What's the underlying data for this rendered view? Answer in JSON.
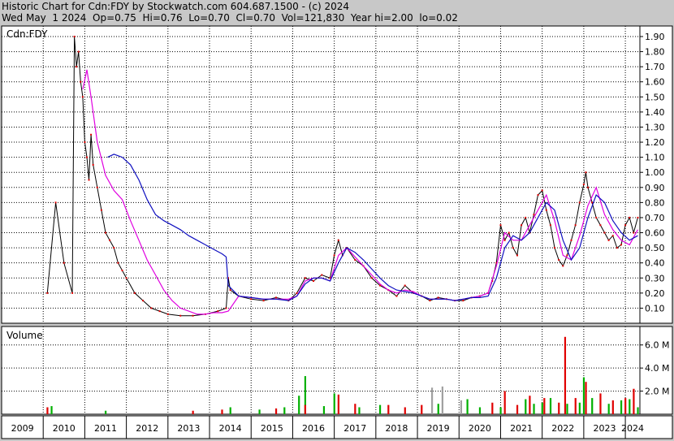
{
  "header": {
    "line1": "Historic Chart for Cdn:FDY by Stockwatch.com 604.687.1500 - (c) 2024",
    "line2": "Wed May  1 2024  Op=0.75  Hi=0.76  Lo=0.70  Cl=0.70  Vol=121,830  Year hi=2.00  lo=0.02"
  },
  "chart_data": [
    {
      "type": "line",
      "name": "price-panel",
      "title": "Cdn:FDY",
      "ylim": [
        0.0,
        1.97
      ],
      "yticks": [
        0.1,
        0.2,
        0.3,
        0.4,
        0.5,
        0.6,
        0.7,
        0.8,
        0.9,
        1.0,
        1.1,
        1.2,
        1.3,
        1.4,
        1.5,
        1.6,
        1.7,
        1.8,
        1.9
      ],
      "ytick_labels": [
        "0.10",
        "0.20",
        "0.30",
        "0.40",
        "0.50",
        "0.60",
        "0.70",
        "0.80",
        "0.90",
        "1.00",
        "1.10",
        "1.20",
        "1.30",
        "1.40",
        "1.50",
        "1.60",
        "1.70",
        "1.80",
        "1.90"
      ],
      "xlim": [
        2009.0,
        2024.35
      ],
      "series": [
        {
          "role": "price",
          "color": "#000000",
          "x": [
            2010.1,
            2010.3,
            2010.5,
            2010.7,
            2010.75,
            2010.8,
            2010.85,
            2010.9,
            2010.95,
            2011.0,
            2011.05,
            2011.1,
            2011.15,
            2011.2,
            2011.3,
            2011.4,
            2011.5,
            2011.6,
            2011.7,
            2011.8,
            2011.9,
            2012.0,
            2012.2,
            2012.4,
            2012.6,
            2012.8,
            2013.0,
            2013.3,
            2013.6,
            2013.9,
            2014.2,
            2014.4,
            2014.45,
            2014.5,
            2014.7,
            2015.0,
            2015.3,
            2015.6,
            2015.9,
            2016.1,
            2016.3,
            2016.5,
            2016.7,
            2016.9,
            2017.0,
            2017.1,
            2017.2,
            2017.3,
            2017.5,
            2017.7,
            2017.9,
            2018.1,
            2018.3,
            2018.5,
            2018.7,
            2018.9,
            2019.1,
            2019.3,
            2019.5,
            2019.7,
            2019.9,
            2020.1,
            2020.3,
            2020.5,
            2020.7,
            2020.8,
            2020.9,
            2021.0,
            2021.1,
            2021.2,
            2021.3,
            2021.4,
            2021.5,
            2021.6,
            2021.7,
            2021.8,
            2021.9,
            2022.0,
            2022.1,
            2022.2,
            2022.3,
            2022.4,
            2022.5,
            2022.6,
            2022.7,
            2022.8,
            2022.9,
            2023.0,
            2023.05,
            2023.1,
            2023.2,
            2023.3,
            2023.4,
            2023.5,
            2023.6,
            2023.7,
            2023.8,
            2023.9,
            2024.0,
            2024.1,
            2024.2,
            2024.3
          ],
          "y": [
            0.2,
            0.8,
            0.4,
            0.2,
            1.9,
            1.7,
            1.8,
            1.6,
            1.5,
            1.2,
            1.1,
            0.95,
            1.25,
            1.05,
            0.9,
            0.75,
            0.6,
            0.55,
            0.5,
            0.4,
            0.35,
            0.3,
            0.2,
            0.15,
            0.1,
            0.08,
            0.06,
            0.05,
            0.05,
            0.06,
            0.08,
            0.1,
            0.3,
            0.22,
            0.18,
            0.16,
            0.15,
            0.17,
            0.15,
            0.2,
            0.3,
            0.28,
            0.32,
            0.3,
            0.45,
            0.55,
            0.45,
            0.5,
            0.42,
            0.38,
            0.3,
            0.25,
            0.22,
            0.18,
            0.25,
            0.2,
            0.18,
            0.15,
            0.17,
            0.16,
            0.15,
            0.15,
            0.17,
            0.18,
            0.2,
            0.28,
            0.4,
            0.65,
            0.55,
            0.6,
            0.5,
            0.45,
            0.65,
            0.7,
            0.6,
            0.72,
            0.85,
            0.88,
            0.75,
            0.65,
            0.5,
            0.42,
            0.38,
            0.45,
            0.55,
            0.65,
            0.8,
            0.92,
            1.0,
            0.9,
            0.8,
            0.7,
            0.65,
            0.6,
            0.55,
            0.58,
            0.5,
            0.52,
            0.65,
            0.7,
            0.6,
            0.7
          ]
        },
        {
          "role": "short-moving-average",
          "color": "#e000e0",
          "x": [
            2010.95,
            2011.05,
            2011.15,
            2011.3,
            2011.5,
            2011.7,
            2011.9,
            2012.1,
            2012.3,
            2012.5,
            2012.7,
            2012.9,
            2013.1,
            2013.3,
            2013.5,
            2013.7,
            2013.9,
            2014.1,
            2014.3,
            2014.45,
            2014.7,
            2015.0,
            2015.3,
            2015.6,
            2015.9,
            2016.1,
            2016.3,
            2016.5,
            2016.7,
            2016.9,
            2017.1,
            2017.3,
            2017.5,
            2017.7,
            2017.9,
            2018.1,
            2018.3,
            2018.5,
            2018.7,
            2018.9,
            2019.1,
            2019.3,
            2019.5,
            2019.7,
            2019.9,
            2020.1,
            2020.3,
            2020.5,
            2020.7,
            2020.9,
            2021.1,
            2021.3,
            2021.5,
            2021.7,
            2021.9,
            2022.1,
            2022.3,
            2022.5,
            2022.7,
            2022.9,
            2023.1,
            2023.3,
            2023.5,
            2023.7,
            2023.9,
            2024.1,
            2024.3
          ],
          "y": [
            1.55,
            1.68,
            1.5,
            1.2,
            0.98,
            0.88,
            0.82,
            0.68,
            0.55,
            0.42,
            0.32,
            0.22,
            0.15,
            0.1,
            0.08,
            0.06,
            0.06,
            0.07,
            0.07,
            0.08,
            0.18,
            0.17,
            0.16,
            0.16,
            0.16,
            0.18,
            0.28,
            0.3,
            0.3,
            0.28,
            0.45,
            0.5,
            0.44,
            0.38,
            0.32,
            0.26,
            0.22,
            0.2,
            0.22,
            0.21,
            0.18,
            0.16,
            0.16,
            0.16,
            0.15,
            0.16,
            0.17,
            0.18,
            0.2,
            0.38,
            0.6,
            0.55,
            0.55,
            0.65,
            0.75,
            0.85,
            0.68,
            0.45,
            0.42,
            0.58,
            0.78,
            0.9,
            0.72,
            0.62,
            0.55,
            0.52,
            0.62
          ]
        },
        {
          "role": "long-moving-average",
          "color": "#1010c0",
          "x": [
            2011.55,
            2011.7,
            2011.9,
            2012.1,
            2012.3,
            2012.5,
            2012.7,
            2012.9,
            2013.1,
            2013.3,
            2013.5,
            2013.7,
            2013.9,
            2014.1,
            2014.3,
            2014.4,
            2014.45,
            2014.7,
            2015.0,
            2015.3,
            2015.6,
            2015.9,
            2016.1,
            2016.3,
            2016.5,
            2016.7,
            2016.9,
            2017.1,
            2017.3,
            2017.5,
            2017.7,
            2017.9,
            2018.1,
            2018.3,
            2018.5,
            2018.7,
            2018.9,
            2019.1,
            2019.3,
            2019.5,
            2019.7,
            2019.9,
            2020.1,
            2020.3,
            2020.5,
            2020.7,
            2020.9,
            2021.1,
            2021.3,
            2021.5,
            2021.7,
            2021.9,
            2022.1,
            2022.3,
            2022.5,
            2022.7,
            2022.9,
            2023.1,
            2023.3,
            2023.5,
            2023.7,
            2023.9,
            2024.1,
            2024.3
          ],
          "y": [
            1.1,
            1.12,
            1.1,
            1.05,
            0.95,
            0.82,
            0.72,
            0.68,
            0.65,
            0.62,
            0.58,
            0.55,
            0.52,
            0.49,
            0.46,
            0.44,
            0.25,
            0.18,
            0.17,
            0.16,
            0.16,
            0.15,
            0.18,
            0.26,
            0.3,
            0.3,
            0.28,
            0.4,
            0.5,
            0.47,
            0.42,
            0.36,
            0.3,
            0.25,
            0.22,
            0.21,
            0.2,
            0.18,
            0.16,
            0.16,
            0.16,
            0.15,
            0.16,
            0.17,
            0.17,
            0.18,
            0.3,
            0.5,
            0.58,
            0.55,
            0.6,
            0.7,
            0.8,
            0.75,
            0.55,
            0.42,
            0.5,
            0.7,
            0.85,
            0.8,
            0.68,
            0.6,
            0.55,
            0.58
          ]
        }
      ]
    },
    {
      "type": "bar",
      "name": "volume-panel",
      "title": "Volume",
      "ylim": [
        0,
        7.6
      ],
      "yticks": [
        2.0,
        4.0,
        6.0
      ],
      "ytick_labels": [
        "2.0 M",
        "4.0 M",
        "6.0 M"
      ],
      "xlim": [
        2009.0,
        2024.35
      ],
      "series": [
        {
          "role": "volume-up",
          "color": "#00b000",
          "x": [
            2010.2,
            2011.5,
            2014.5,
            2015.2,
            2015.8,
            2016.15,
            2016.3,
            2016.75,
            2017.0,
            2017.6,
            2018.1,
            2019.5,
            2020.2,
            2020.5,
            2021.0,
            2021.6,
            2021.8,
            2022.0,
            2022.2,
            2022.6,
            2022.9,
            2023.0,
            2023.2,
            2023.6,
            2023.9,
            2024.1,
            2024.3
          ],
          "y": [
            0.7,
            0.3,
            0.6,
            0.4,
            0.6,
            1.6,
            3.3,
            0.7,
            1.8,
            0.6,
            0.8,
            0.9,
            1.3,
            0.6,
            0.6,
            1.3,
            0.9,
            1.0,
            1.4,
            0.9,
            1.0,
            3.2,
            1.4,
            0.9,
            1.2,
            1.3,
            0.6
          ]
        },
        {
          "role": "volume-down",
          "color": "#e00000",
          "x": [
            2010.1,
            2013.6,
            2014.3,
            2015.6,
            2016.3,
            2017.1,
            2017.5,
            2018.3,
            2018.7,
            2019.1,
            2020.8,
            2021.1,
            2021.4,
            2021.7,
            2022.05,
            2022.4,
            2022.55,
            2022.8,
            2023.05,
            2023.4,
            2023.7,
            2024.0,
            2024.2
          ],
          "y": [
            0.6,
            0.3,
            0.4,
            0.5,
            0.8,
            1.7,
            0.9,
            0.8,
            0.6,
            0.8,
            1.0,
            2.0,
            0.8,
            1.6,
            1.4,
            1.0,
            6.7,
            1.4,
            2.8,
            1.8,
            1.2,
            1.4,
            2.2
          ]
        },
        {
          "role": "volume-unchanged",
          "color": "#a0a0a0",
          "x": [
            2019.35,
            2019.6,
            2020.05
          ],
          "y": [
            2.3,
            2.4,
            1.2
          ]
        }
      ]
    },
    {
      "type": "axis",
      "name": "year-axis",
      "years": [
        2009,
        2010,
        2011,
        2012,
        2013,
        2014,
        2015,
        2016,
        2017,
        2018,
        2019,
        2020,
        2021,
        2022,
        2023,
        2024
      ],
      "labels": [
        "2009",
        "2010",
        "2011",
        "2012",
        "2013",
        "2014",
        "2015",
        "2016",
        "2017",
        "2018",
        "2019",
        "2020",
        "2021",
        "2022",
        "2023",
        "2024"
      ]
    }
  ],
  "colors": {
    "panel_bg": "#ffffff",
    "page_bg": "#c8c8c8",
    "grid": "#000000"
  }
}
